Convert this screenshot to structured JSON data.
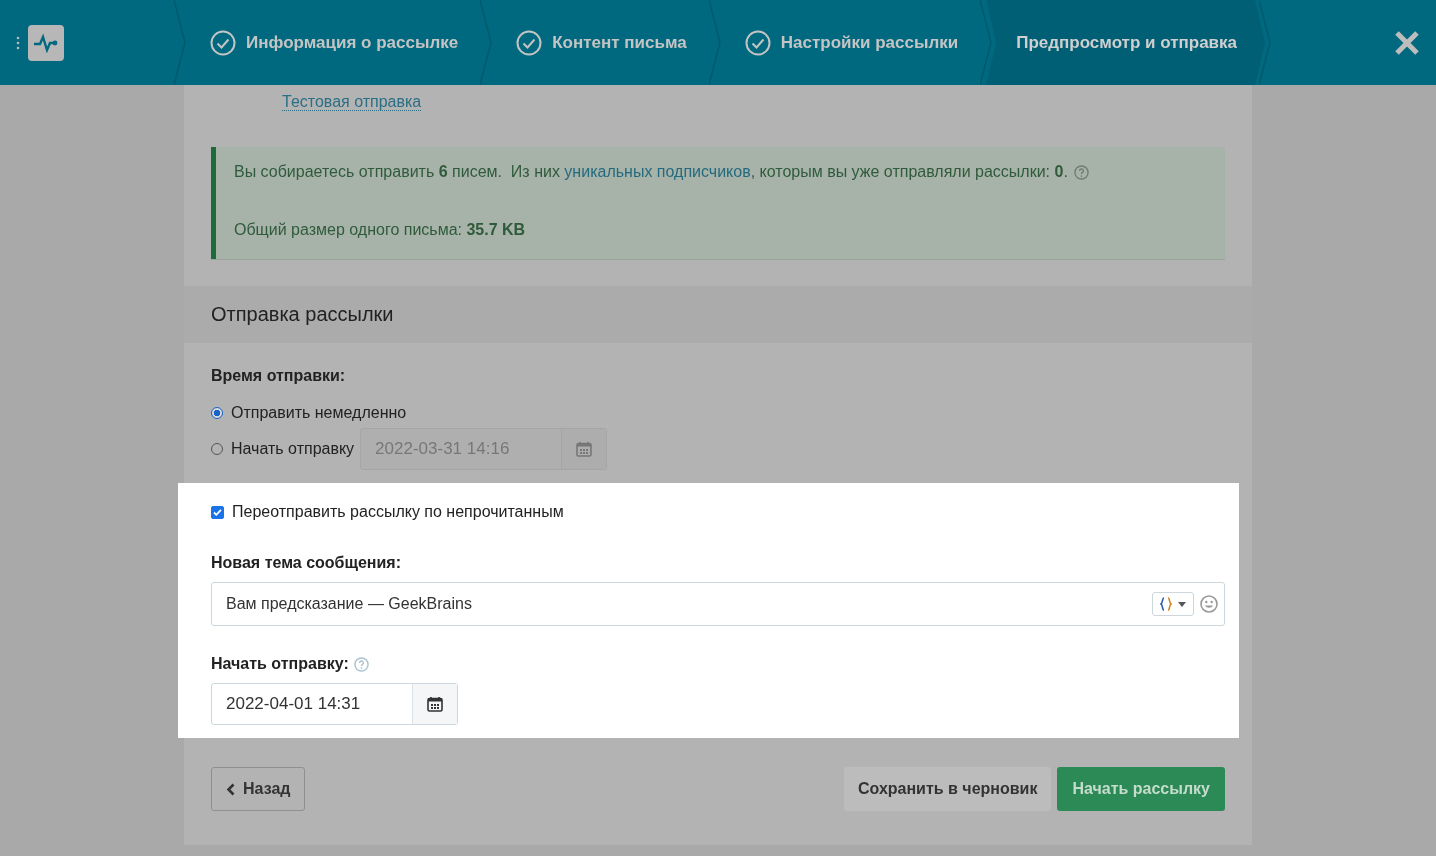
{
  "steps": [
    {
      "label": "Информация о рассылке",
      "done": true,
      "selected": false
    },
    {
      "label": "Контент письма",
      "done": true,
      "selected": false
    },
    {
      "label": "Настройки рассылки",
      "done": true,
      "selected": false
    },
    {
      "label": "Предпросмотр и отправка",
      "done": false,
      "selected": true
    }
  ],
  "test_send_link": "Тестовая отправка",
  "info": {
    "before": "Вы собираетесь отправить **6** писем.  Из них ",
    "link": "уникальных подписчиков",
    "after": ", которым вы уже отправляли рассылки: **0**.",
    "size": "Общий размер одного письма: **35.7 KB**"
  },
  "section_title": "Отправка рассылки",
  "send_time": {
    "label": "Время отправки:",
    "options": [
      {
        "label": "Отправить немедленно",
        "selected": true
      },
      {
        "label": "Начать отправку",
        "selected": false,
        "date": "2022-03-31 14:16"
      }
    ]
  },
  "resend": {
    "label": "Переотправить рассылку по непрочитанным",
    "checked": true,
    "subject_label": "Новая тема сообщения:",
    "subject_value": "Вам предсказание — GeekBrains",
    "start_label": "Начать отправку:",
    "start_value": "2022-04-01 14:31"
  },
  "buttons": {
    "back": "Назад",
    "save": "Сохранить в черновик",
    "start": "Начать рассылку"
  }
}
